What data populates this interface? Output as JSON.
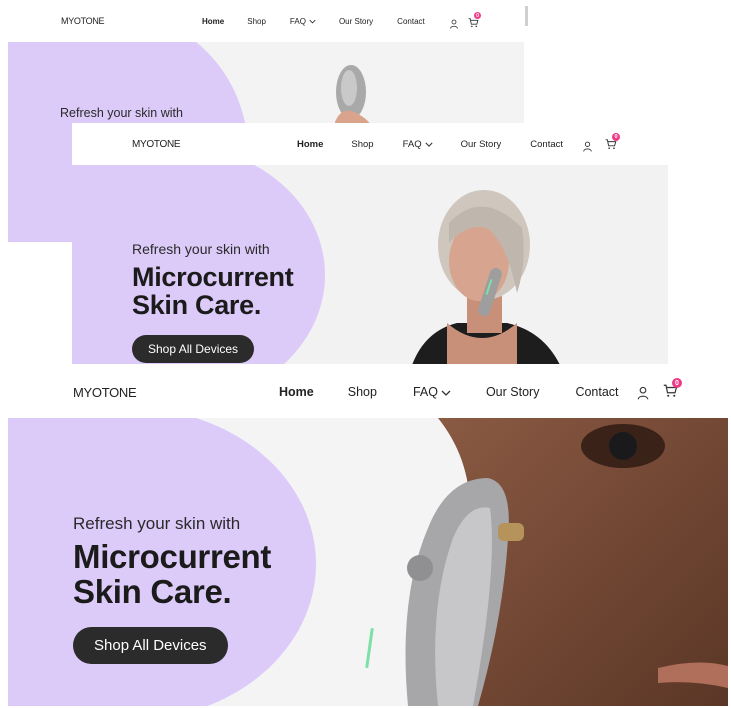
{
  "brand": {
    "logo": "MYOTONE"
  },
  "nav": {
    "items": [
      {
        "label": "Home",
        "active": true
      },
      {
        "label": "Shop"
      },
      {
        "label": "FAQ"
      },
      {
        "label": "Our Story"
      },
      {
        "label": "Contact"
      }
    ],
    "cart_count": "0"
  },
  "hero": {
    "subtitle": "Refresh your skin with",
    "headline_line1": "Microcurrent",
    "headline_line2": "Skin Care",
    "headline_dot": ".",
    "cta_label": "Shop All Devices"
  },
  "icons": {
    "account": "account-icon",
    "cart": "cart-icon",
    "chevron": "chevron-down-icon"
  },
  "colors": {
    "accent_lavender": "#dccaf9",
    "cta_bg": "#2b2b2b",
    "badge": "#ee3b88"
  }
}
